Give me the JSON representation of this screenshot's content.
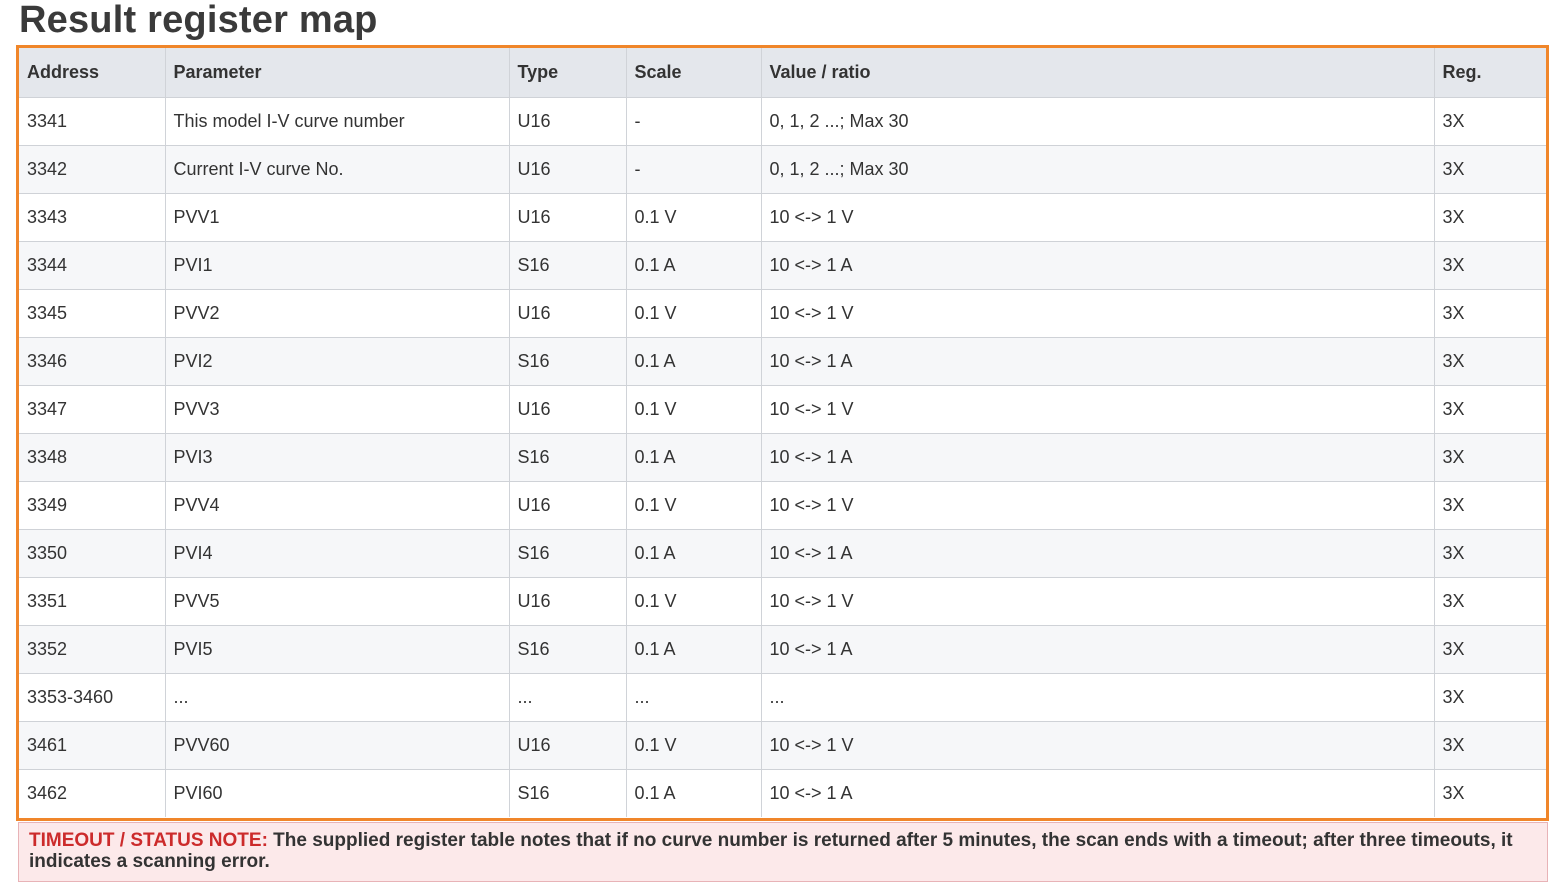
{
  "page": {
    "title": "Result register map"
  },
  "table": {
    "columns": [
      "Address",
      "Parameter",
      "Type",
      "Scale",
      "Value / ratio",
      "Reg."
    ],
    "rows": [
      [
        "3341",
        "This model I-V curve number",
        "U16",
        "-",
        "0, 1, 2 ...; Max 30",
        "3X"
      ],
      [
        "3342",
        "Current I-V curve No.",
        "U16",
        "-",
        "0, 1, 2 ...; Max 30",
        "3X"
      ],
      [
        "3343",
        "PVV1",
        "U16",
        "0.1 V",
        "10 <-> 1 V",
        "3X"
      ],
      [
        "3344",
        "PVI1",
        "S16",
        "0.1 A",
        "10 <-> 1 A",
        "3X"
      ],
      [
        "3345",
        "PVV2",
        "U16",
        "0.1 V",
        "10 <-> 1 V",
        "3X"
      ],
      [
        "3346",
        "PVI2",
        "S16",
        "0.1 A",
        "10 <-> 1 A",
        "3X"
      ],
      [
        "3347",
        "PVV3",
        "U16",
        "0.1 V",
        "10 <-> 1 V",
        "3X"
      ],
      [
        "3348",
        "PVI3",
        "S16",
        "0.1 A",
        "10 <-> 1 A",
        "3X"
      ],
      [
        "3349",
        "PVV4",
        "U16",
        "0.1 V",
        "10 <-> 1 V",
        "3X"
      ],
      [
        "3350",
        "PVI4",
        "S16",
        "0.1 A",
        "10 <-> 1 A",
        "3X"
      ],
      [
        "3351",
        "PVV5",
        "U16",
        "0.1 V",
        "10 <-> 1 V",
        "3X"
      ],
      [
        "3352",
        "PVI5",
        "S16",
        "0.1 A",
        "10 <-> 1 A",
        "3X"
      ],
      [
        "3353-3460",
        "...",
        "...",
        "...",
        "...",
        "3X"
      ],
      [
        "3461",
        "PVV60",
        "U16",
        "0.1 V",
        "10 <-> 1 V",
        "3X"
      ],
      [
        "3462",
        "PVI60",
        "S16",
        "0.1 A",
        "10 <-> 1 A",
        "3X"
      ]
    ]
  },
  "note": {
    "label": "TIMEOUT / STATUS NOTE:",
    "text": " The supplied register table notes that if no curve number is returned after 5 minutes, the scan ends with a timeout; after three timeouts, it indicates a scanning error."
  },
  "colors": {
    "table_border": "#f0862a",
    "header_bg": "#e4e7ec",
    "note_bg": "#fce9ea",
    "note_label": "#cc2b2b"
  }
}
